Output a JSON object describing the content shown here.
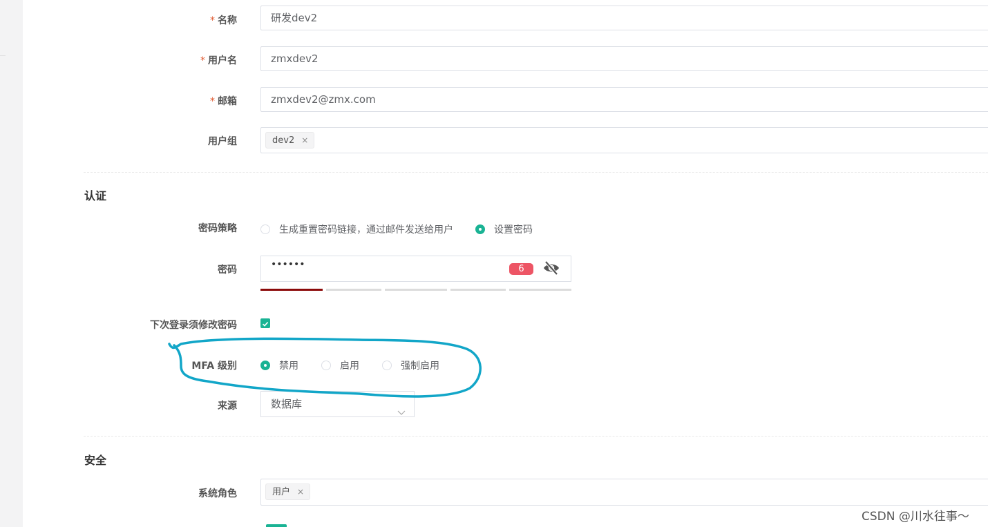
{
  "form": {
    "name": {
      "label": "名称",
      "value": "研发dev2"
    },
    "username": {
      "label": "用户名",
      "value": "zmxdev2"
    },
    "email": {
      "label": "邮箱",
      "value": "zmxdev2@zmx.com"
    },
    "groups": {
      "label": "用户组",
      "tags": [
        "dev2"
      ]
    },
    "required_mark": "*",
    "tag_close": "×"
  },
  "auth": {
    "section_title": "认证",
    "password_strategy": {
      "label": "密码策略",
      "options": [
        "生成重置密码链接，通过邮件发送给用户",
        "设置密码"
      ],
      "selected": "设置密码"
    },
    "password": {
      "label": "密码",
      "masked_value": "••••••",
      "length_badge": "6",
      "strength_segments": 5,
      "strength_level": 1
    },
    "must_change": {
      "label": "下次登录须修改密码",
      "checked": true
    },
    "mfa": {
      "label": "MFA 级别",
      "options": [
        "禁用",
        "启用",
        "强制启用"
      ],
      "selected": "禁用"
    },
    "source": {
      "label": "来源",
      "value": "数据库"
    }
  },
  "security": {
    "section_title": "安全",
    "system_roles": {
      "label": "系统角色",
      "tags": [
        "用户"
      ]
    }
  },
  "colors": {
    "accent": "#1ab394",
    "danger": "#ed5565",
    "strength_weak": "#8b0a0a",
    "annotation": "#12a6c8"
  },
  "watermark": "CSDN @川水往事～"
}
